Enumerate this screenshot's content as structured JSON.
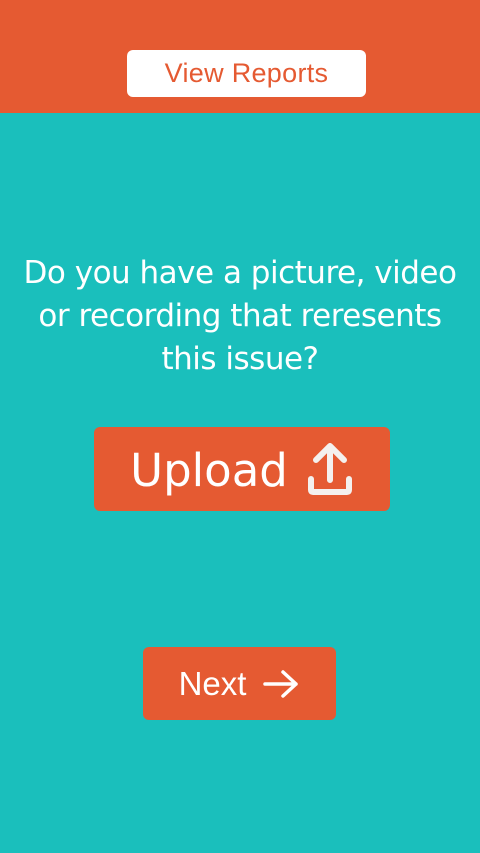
{
  "header": {
    "view_reports_label": "View Reports"
  },
  "main": {
    "question_lines": [
      "Do you have a picture, video",
      "or recording that reresents",
      "this issue?"
    ],
    "upload_label": "Upload",
    "upload_icon": "upload-icon",
    "next_label": "Next",
    "next_icon": "arrow-right-icon"
  },
  "colors": {
    "background": "#1ABFBC",
    "accent": "#E55A32",
    "button_text": "#FFFFFF"
  }
}
